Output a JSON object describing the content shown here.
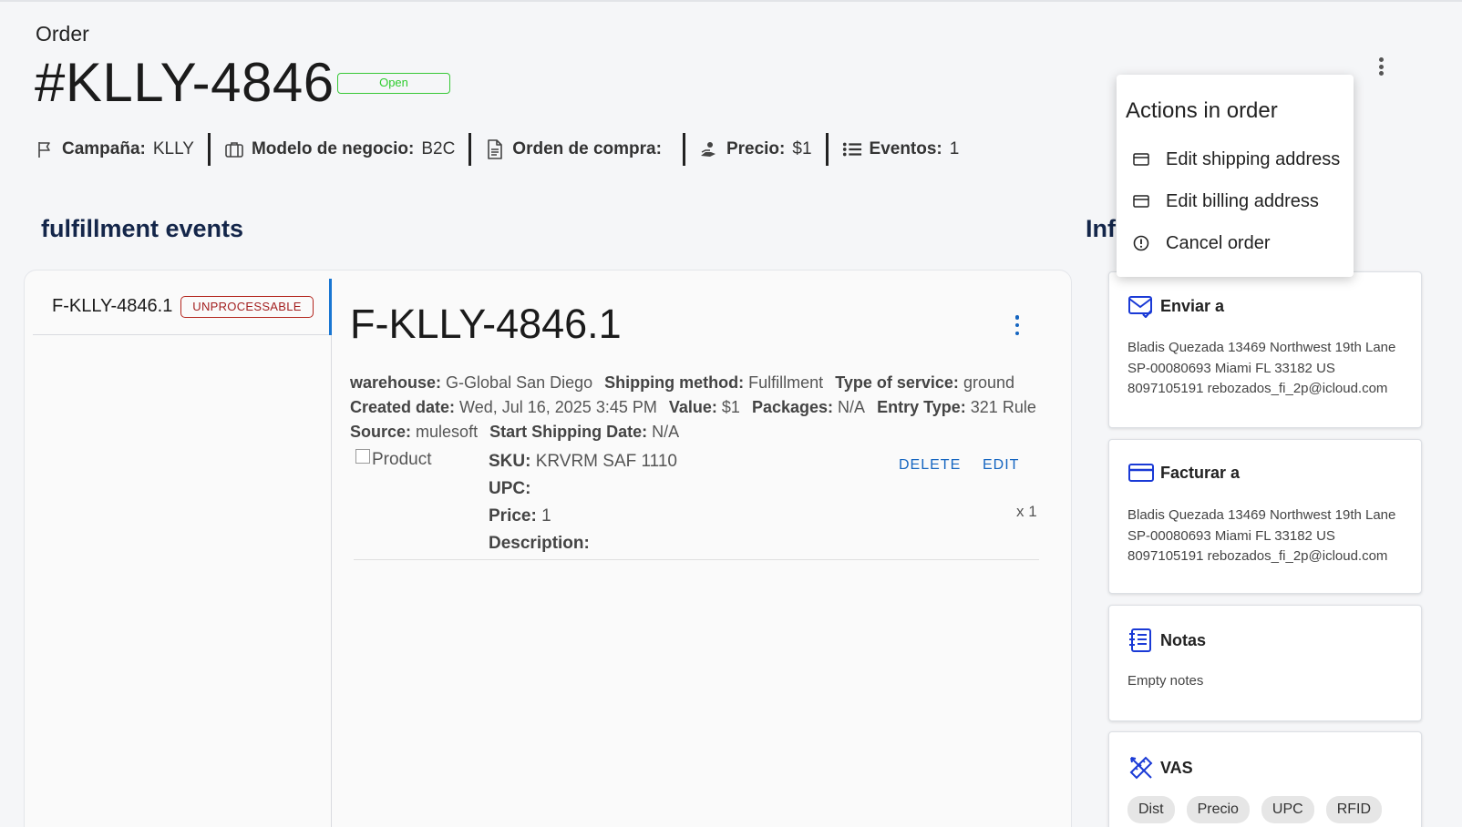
{
  "header": {
    "label": "Order",
    "order_id": "#KLLY-4846",
    "status": "Open"
  },
  "meta": [
    {
      "icon": "flag-icon",
      "label": "Campaña:",
      "value": "KLLY"
    },
    {
      "icon": "briefcase-icon",
      "label": "Modelo de negocio:",
      "value": "B2C"
    },
    {
      "icon": "document-icon",
      "label": "Orden de compra:",
      "value": ""
    },
    {
      "icon": "hand-coin-icon",
      "label": "Precio:",
      "value": "$1"
    },
    {
      "icon": "list-icon",
      "label": "Eventos:",
      "value": "1"
    }
  ],
  "sections": {
    "fulfillment_title": "fulfillment events",
    "info_title": "Inf"
  },
  "fulfillment_list": [
    {
      "id": "F-KLLY-4846.1",
      "badge": "UNPROCESSABLE"
    }
  ],
  "fulfillment_detail": {
    "title": "F-KLLY-4846.1",
    "warehouse_label": "warehouse:",
    "warehouse": "G-Global San Diego",
    "shipping_label": "Shipping method:",
    "shipping": "Fulfillment",
    "service_label": "Type of service:",
    "service": "ground",
    "created_label": "Created date:",
    "created": "Wed, Jul 16, 2025 3:45 PM",
    "value_label": "Value:",
    "value": "$1",
    "packages_label": "Packages:",
    "packages": "N/A",
    "entry_label": "Entry Type:",
    "entry": "321 Rule",
    "source_label": "Source:",
    "source": "mulesoft",
    "start_label": "Start Shipping Date:",
    "start": "N/A"
  },
  "product": {
    "img_alt": "Product",
    "sku_label": "SKU:",
    "sku": "KRVRM SAF 1110",
    "upc_label": "UPC:",
    "upc": "",
    "price_label": "Price:",
    "price": "1",
    "desc_label": "Description:",
    "desc": "",
    "delete_label": "DELETE",
    "edit_label": "EDIT",
    "qty": "x 1"
  },
  "cards": {
    "ship": {
      "title": "Enviar a",
      "line1": "Bladis Quezada 13469 Northwest 19th Lane",
      "line2": "SP-00080693 Miami FL 33182 US",
      "line3": "8097105191 rebozados_fi_2p@icloud.com"
    },
    "bill": {
      "title": "Facturar a",
      "line1": "Bladis Quezada 13469 Northwest 19th Lane",
      "line2": "SP-00080693 Miami FL 33182 US",
      "line3": "8097105191 rebozados_fi_2p@icloud.com"
    },
    "notes": {
      "title": "Notas",
      "body": "Empty notes"
    },
    "vas": {
      "title": "VAS",
      "chips": [
        "Dist",
        "Precio",
        "UPC",
        "RFID"
      ]
    }
  },
  "menu": {
    "title": "Actions in order",
    "items": [
      "Edit shipping address",
      "Edit billing address",
      "Cancel order"
    ]
  },
  "colors": {
    "accent": "#1565c0",
    "heading": "#14264a",
    "status_open": "#2ecc2e",
    "status_unprocessable": "#a32020",
    "card_icon": "#1a3ad6"
  }
}
